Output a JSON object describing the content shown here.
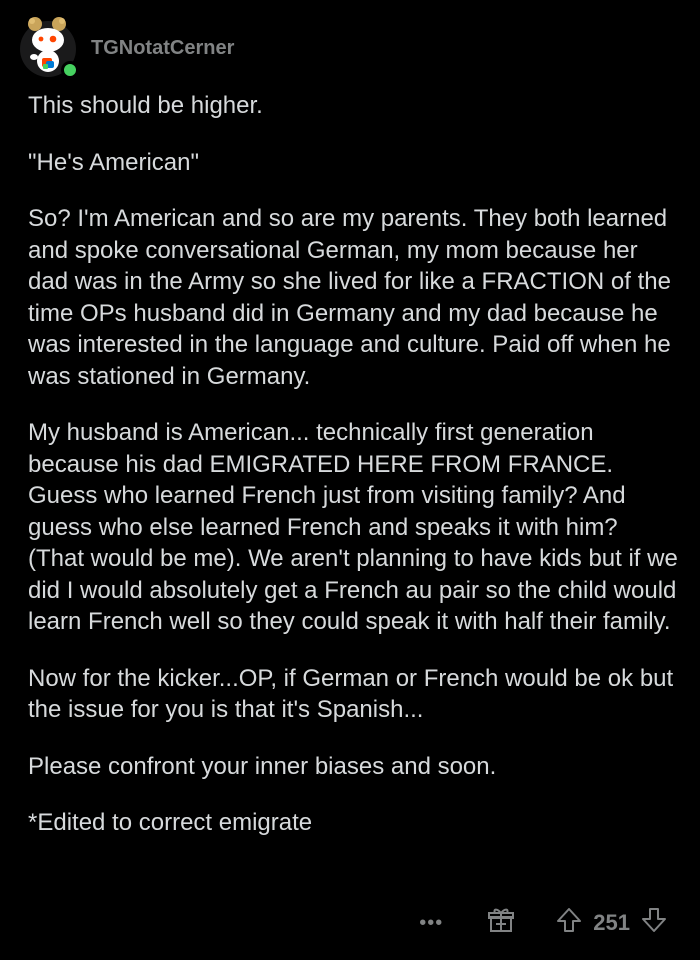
{
  "comment": {
    "username": "TGNotatCerner",
    "paragraphs": [
      "This should be higher.",
      "\"He's American\"",
      "So? I'm American and so are my parents. They both learned and spoke conversational German, my mom because her dad was in the Army so she lived for like a FRACTION of the time OPs husband did in Germany and my dad because he was interested in the language and culture. Paid off when he was stationed in Germany.",
      "My husband is American... technically first generation because his dad EMIGRATED HERE FROM FRANCE. Guess who learned French just from visiting family? And guess who else learned French and speaks it with him? (That would be me). We aren't planning to have kids but if we did I would absolutely get a French au pair so the child would learn French well so they could speak it with half their family.",
      "Now for the kicker...OP, if German or French would be ok but the issue for you is that it's Spanish...",
      "Please confront your inner biases and soon.",
      "*Edited to correct emigrate"
    ],
    "score": "251"
  },
  "icons": {
    "avatar": "snoo-avatar",
    "online": "online-status-dot",
    "more": "more-options-icon",
    "award": "award-icon",
    "upvote": "upvote-arrow-icon",
    "downvote": "downvote-arrow-icon"
  },
  "colors": {
    "background": "#000000",
    "text": "#d7dadc",
    "muted": "#818384",
    "online": "#46d160"
  }
}
